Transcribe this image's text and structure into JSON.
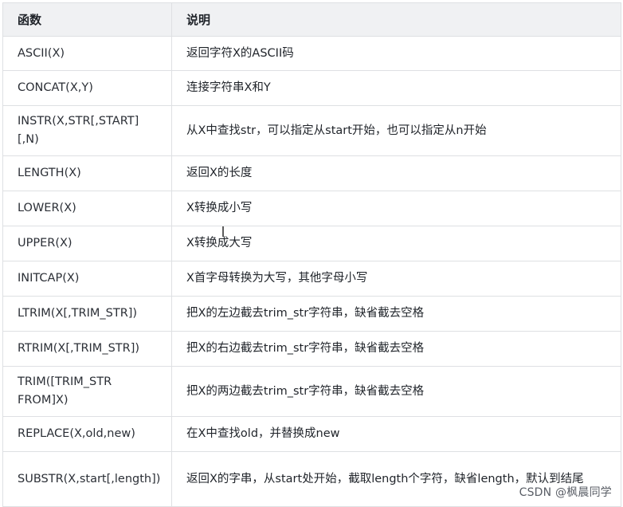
{
  "table": {
    "headers": {
      "function": "函数",
      "description": "说明"
    },
    "rows": [
      {
        "function": "ASCII(X)",
        "description": "返回字符X的ASCII码"
      },
      {
        "function": "CONCAT(X,Y)",
        "description": "连接字符串X和Y"
      },
      {
        "function": "INSTR(X,STR[,START][,N)",
        "description": "从X中查找str，可以指定从start开始，也可以指定从n开始"
      },
      {
        "function": "LENGTH(X)",
        "description": "返回X的长度"
      },
      {
        "function": "LOWER(X)",
        "description": "X转换成小写"
      },
      {
        "function": "UPPER(X)",
        "description": "X转换成大写"
      },
      {
        "function": "INITCAP(X)",
        "description": "X首字母转换为大写，其他字母小写"
      },
      {
        "function": "LTRIM(X[,TRIM_STR])",
        "description": "把X的左边截去trim_str字符串，缺省截去空格"
      },
      {
        "function": "RTRIM(X[,TRIM_STR])",
        "description": "把X的右边截去trim_str字符串，缺省截去空格"
      },
      {
        "function": "TRIM([TRIM_STR FROM]X)",
        "description": "把X的两边截去trim_str字符串，缺省截去空格"
      },
      {
        "function": "REPLACE(X,old,new)",
        "description": "在X中查找old，并替换成new"
      },
      {
        "function": "SUBSTR(X,start[,length])",
        "description": "返回X的字串，从start处开始，截取length个字符，缺省length，默认到结尾"
      }
    ]
  },
  "watermark": "CSDN @枫晨同学"
}
